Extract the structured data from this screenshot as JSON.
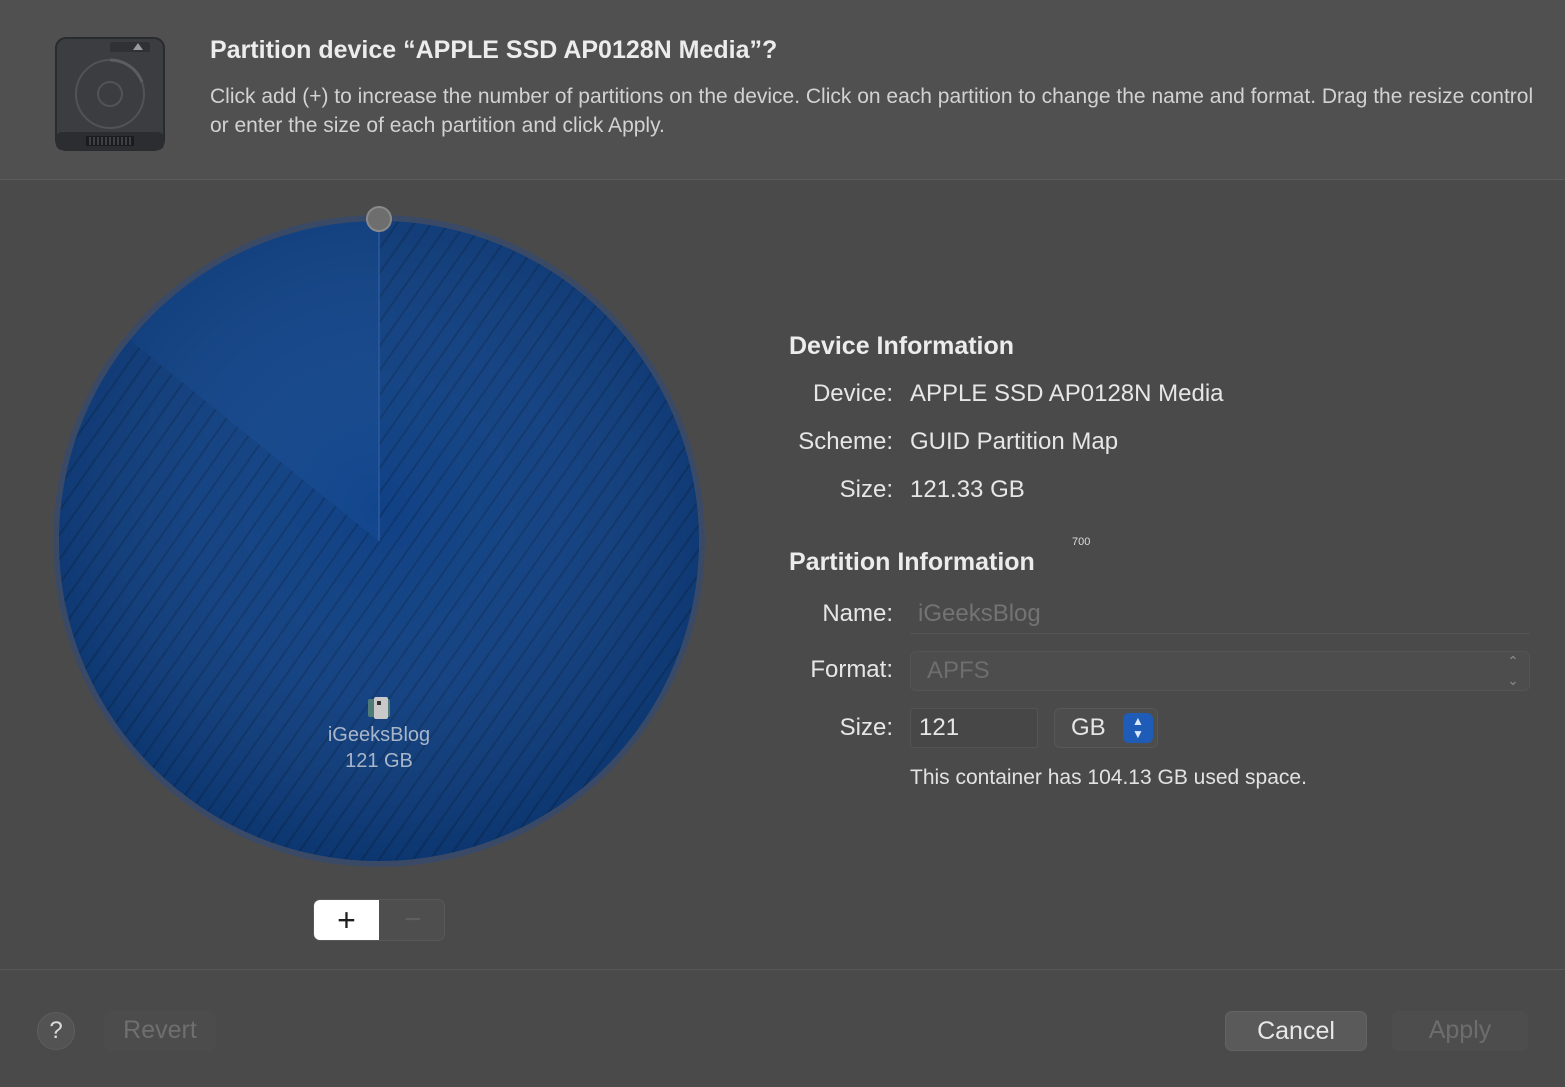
{
  "header": {
    "title": "Partition device “APPLE SSD AP0128N Media”?",
    "description": "Click add (+) to increase the number of partitions on the device. Click on each partition to change the name and format. Drag the resize control or enter the size of each partition and click Apply."
  },
  "pie": {
    "partition_name": "iGeeksBlog",
    "partition_size": "121 GB",
    "used_fraction": 0.858,
    "color": "#0a3f86"
  },
  "stepper": {
    "add": "+",
    "remove": "−"
  },
  "device_info": {
    "heading": "Device Information",
    "device_label": "Device:",
    "device_value": "APPLE SSD AP0128N Media",
    "scheme_label": "Scheme:",
    "scheme_value": "GUID Partition Map",
    "size_label": "Size:",
    "size_value": "121.33 GB"
  },
  "stray_label": "700",
  "partition_info": {
    "heading": "Partition Information",
    "name_label": "Name:",
    "name_value": "iGeeksBlog",
    "format_label": "Format:",
    "format_value": "APFS",
    "size_label": "Size:",
    "size_value": "121",
    "size_unit": "GB",
    "used_text": "This container has 104.13 GB used space."
  },
  "footer": {
    "help": "?",
    "revert": "Revert",
    "cancel": "Cancel",
    "apply": "Apply"
  },
  "colors": {
    "accent": "#1f5cb8",
    "background": "#4a4a4a"
  }
}
